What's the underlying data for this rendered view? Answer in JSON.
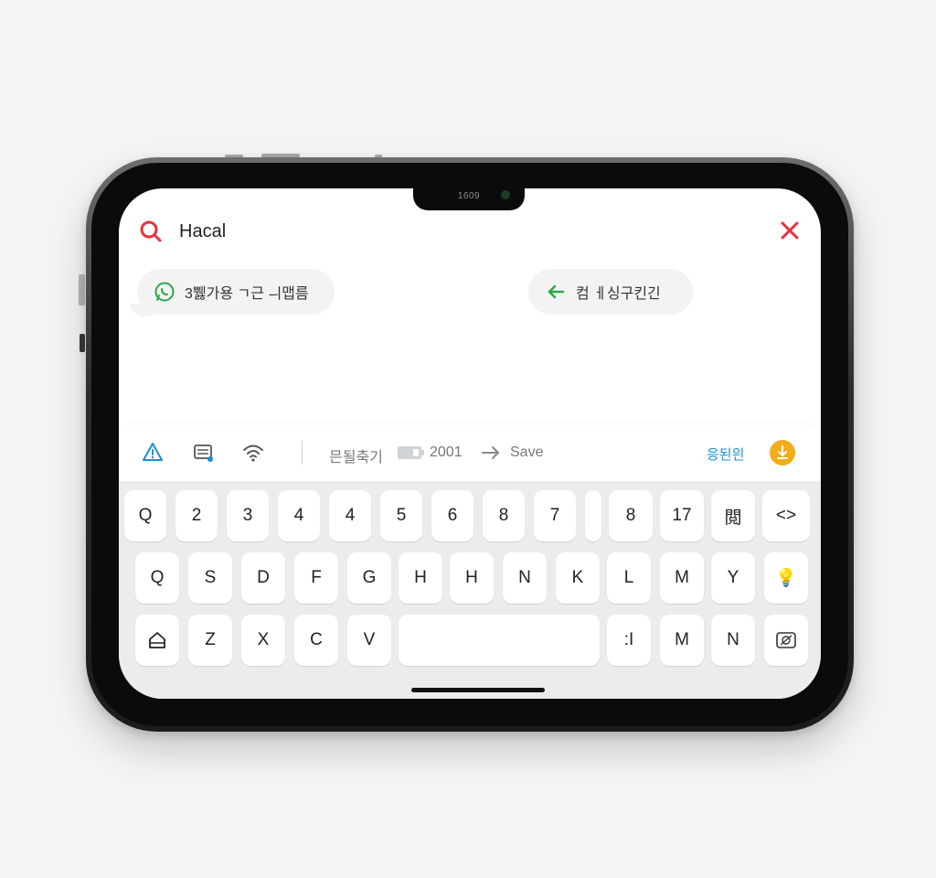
{
  "notch": {
    "label": "1609"
  },
  "search": {
    "value": "Hacal"
  },
  "chips": {
    "left": {
      "label": "3쀓가용 ㄱ근 ㅢ맵름"
    },
    "right": {
      "label": "컴 ㅔ싱구킨긴"
    }
  },
  "toolbar": {
    "text_korean": "믄될축기",
    "number": "2001",
    "save_label": "Save",
    "badge_label": "응된읜"
  },
  "keyboard": {
    "row1": [
      "Q",
      "2",
      "3",
      "4",
      "4",
      "5",
      "6",
      "8",
      "7",
      "",
      "8",
      "17",
      "閲",
      "<>"
    ],
    "row2": [
      "Q",
      "S",
      "D",
      "F",
      "G",
      "H",
      "H",
      "N",
      "K",
      "L",
      "M",
      "Y",
      "💡"
    ],
    "row3_letters": [
      "Z",
      "X",
      "C",
      "V"
    ],
    "row3_right": [
      ":I",
      "M",
      "N"
    ]
  },
  "colors": {
    "search_icon": "#e8323c",
    "close_icon": "#e8323c",
    "chip_left_icon": "#2aa84a",
    "chip_right_icon": "#2aa84a",
    "toolbar_accent": "#1a8fd6",
    "coin": "#f2ad1c"
  },
  "icons": {
    "search": "search-icon",
    "close": "close-icon",
    "chip_left": "whatsapp-icon",
    "chip_right": "arrow-left-icon",
    "toolbar": [
      "alert-icon",
      "keyboard-settings-icon",
      "wifi-icon",
      "battery-icon",
      "arrow-right-icon",
      "coin-icon"
    ],
    "keyboard": [
      "home-icon",
      "emoji-icon"
    ]
  }
}
